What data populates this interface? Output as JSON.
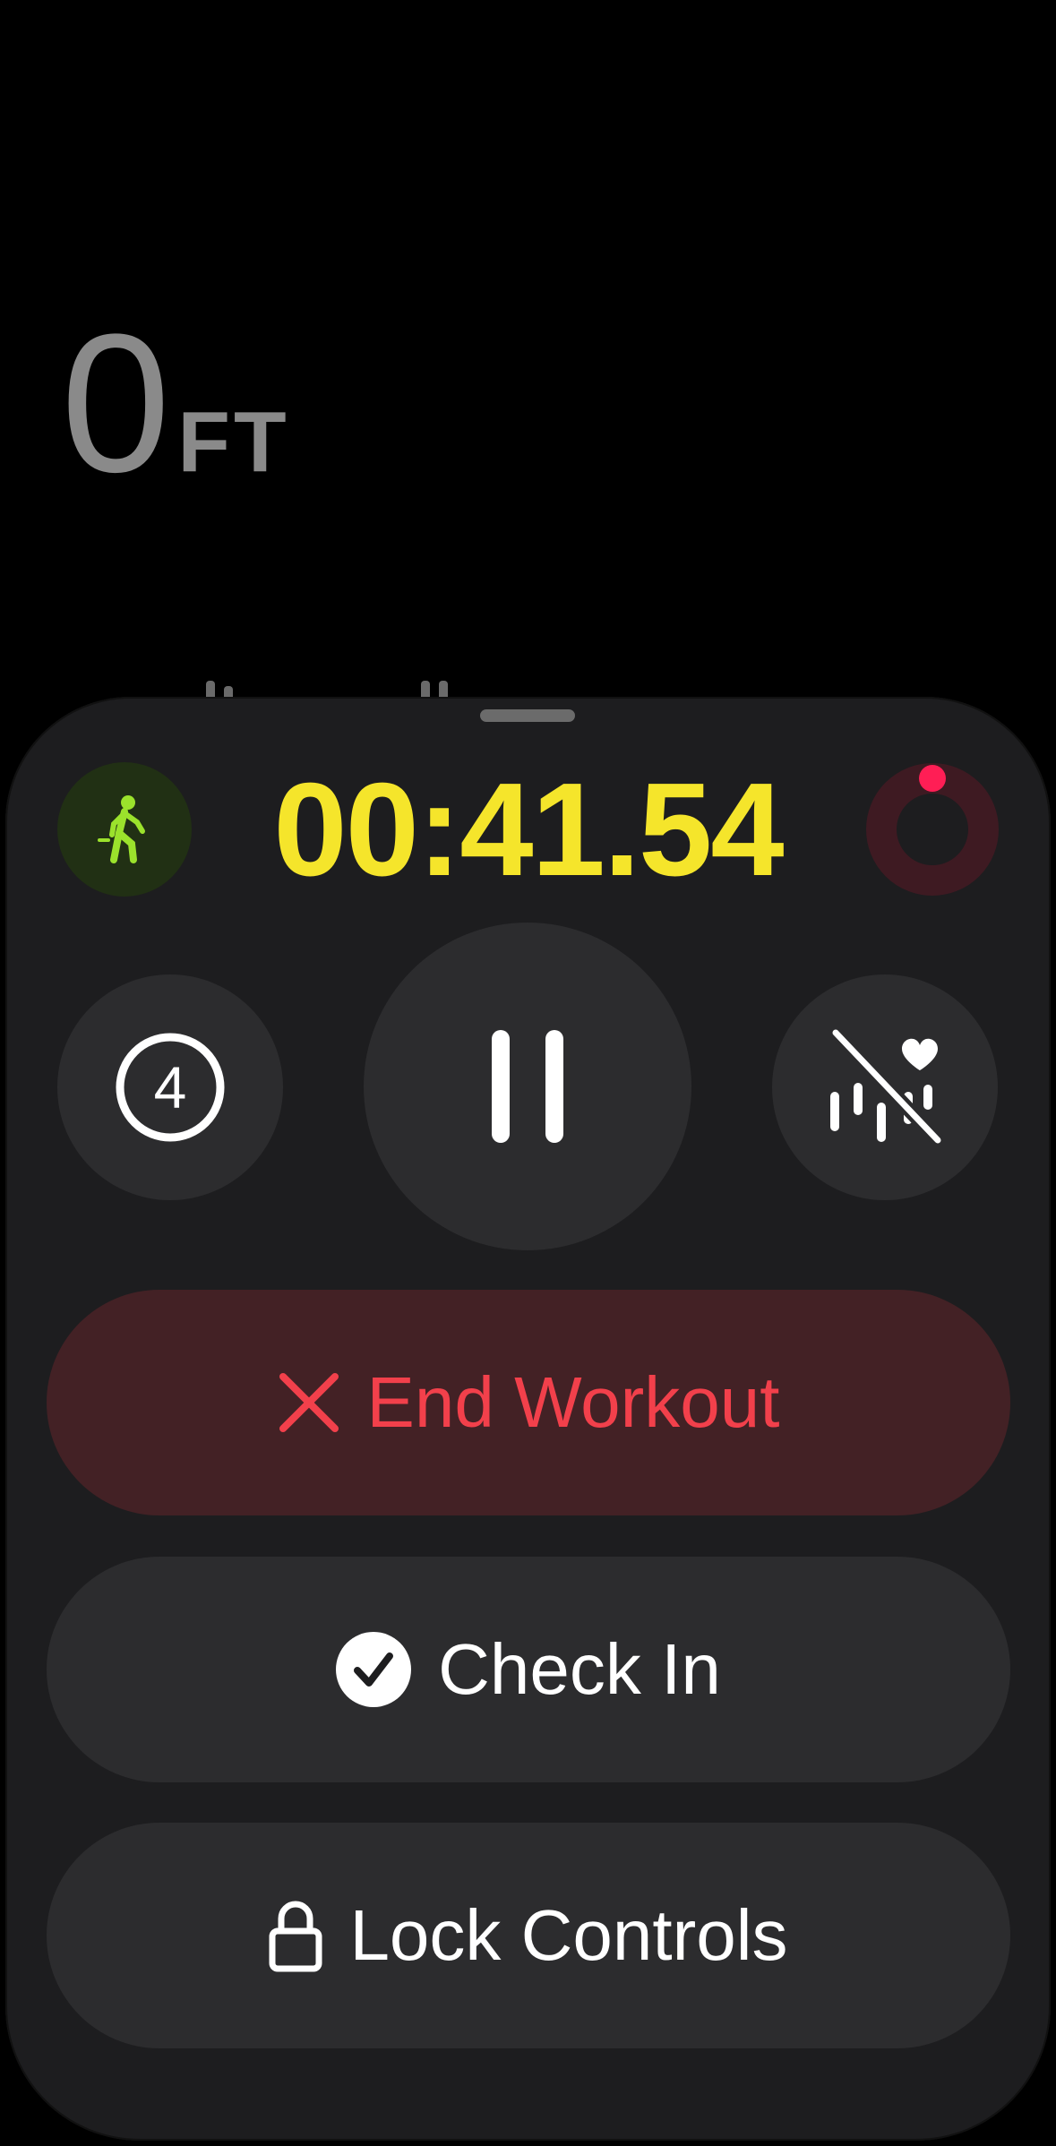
{
  "metric": {
    "value": "0",
    "unit": "FT"
  },
  "timer": {
    "elapsed": "00:41.54"
  },
  "icons": {
    "activity": "walking-figure-icon",
    "ring": "activity-ring-icon",
    "laps": "lap-count-icon",
    "pause": "pause-icon",
    "heart_rate": "heart-rate-off-icon",
    "end": "close-x-icon",
    "check_in": "checkmark-circle-icon",
    "lock": "lock-icon"
  },
  "controls": {
    "laps_count": "4",
    "end_workout": "End Workout",
    "check_in": "Check In",
    "lock_controls": "Lock Controls"
  },
  "colors": {
    "timer": "#f5e52b",
    "activity_green": "#9be22c",
    "end_red": "#f2404b",
    "end_bg": "#432125",
    "ring_red": "#ff1e55",
    "button_bg": "#2c2c2e",
    "sheet_bg": "#1d1d1f"
  }
}
